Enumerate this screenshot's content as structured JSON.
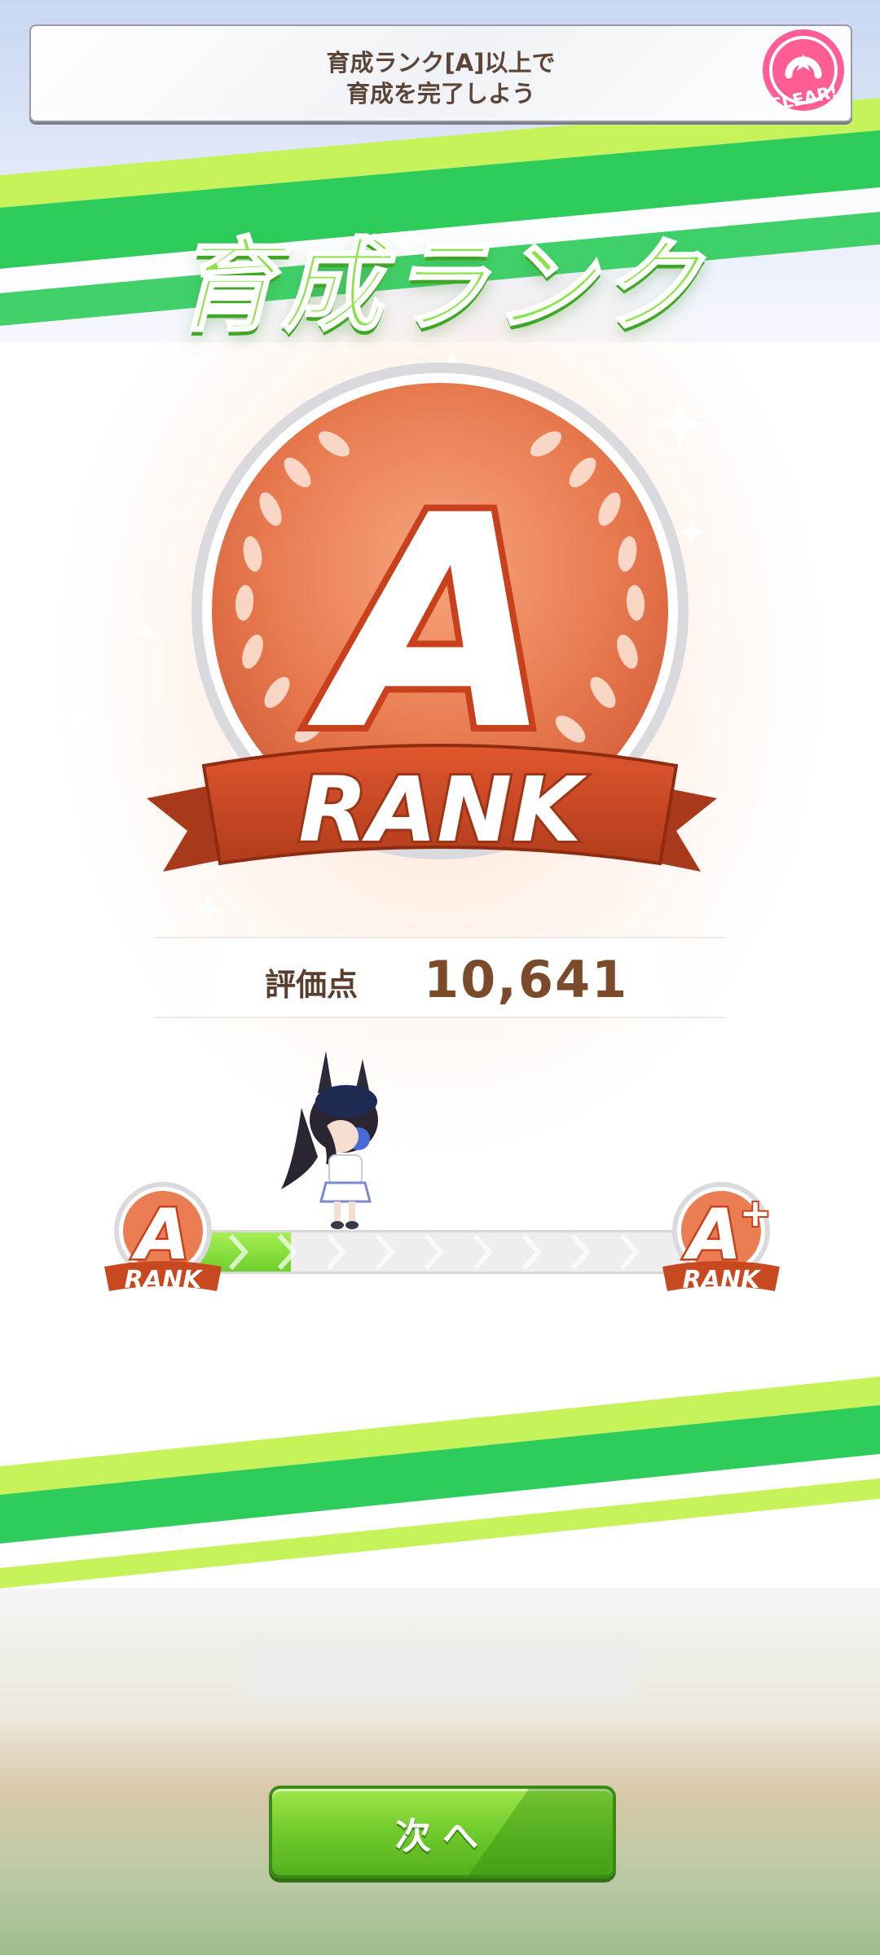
{
  "mission": {
    "line1": "育成ランク[A]以上で",
    "line2": "育成を完了しよう",
    "stamp_label": "CLEAR!"
  },
  "title": "育成ランク",
  "medal": {
    "letter": "A",
    "ribbon_label": "RANK",
    "color": "#e8774a"
  },
  "score": {
    "label": "評価点",
    "value": "10,641"
  },
  "progress": {
    "current_rank_letter": "A",
    "current_rank_label": "RANK",
    "next_rank_letter": "A",
    "next_rank_suffix": "+",
    "next_rank_label": "RANK",
    "fraction": 0.19
  },
  "button": {
    "next_label": "次へ"
  },
  "colors": {
    "accent_green": "#6cc82a",
    "stripe_green": "#2ecc5a",
    "lime": "#c6f25a",
    "brown_text": "#5b4536"
  }
}
